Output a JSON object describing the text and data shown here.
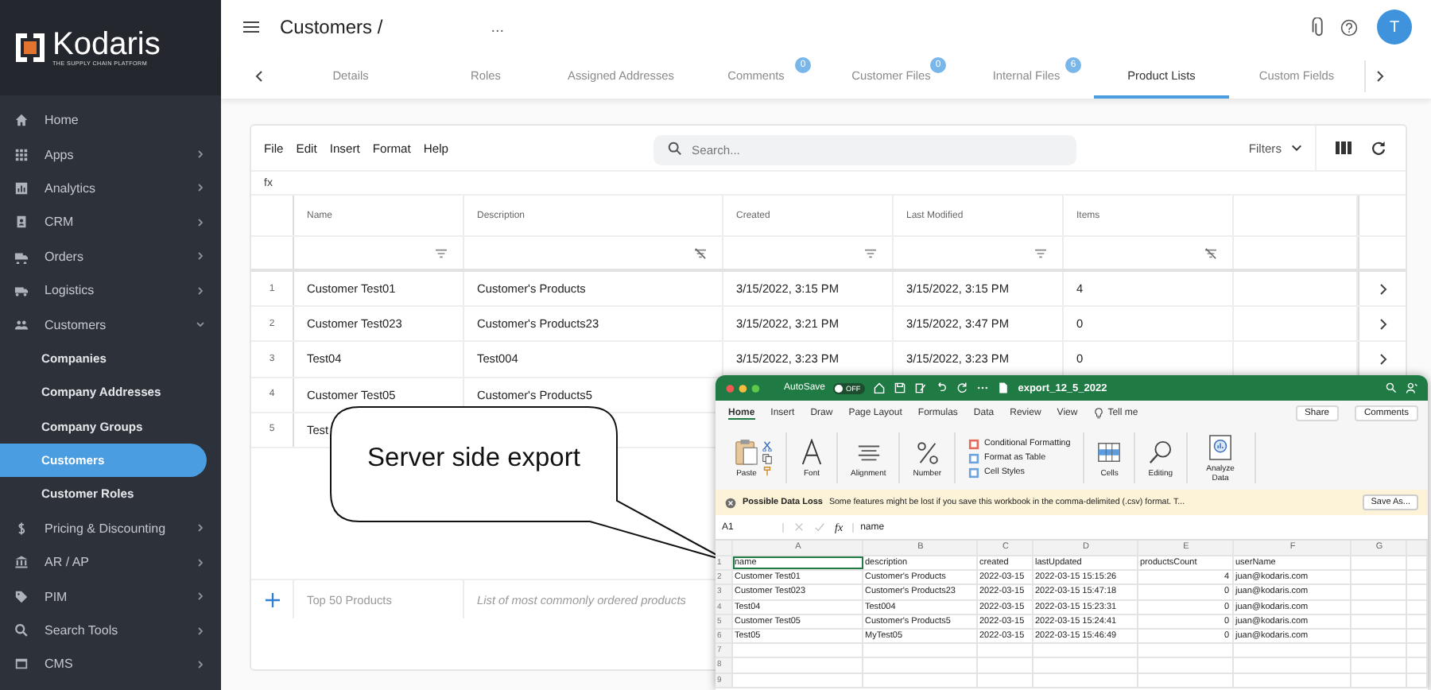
{
  "sidebar": {
    "logo": {
      "name": "Kodaris",
      "tagline": "THE SUPPLY CHAIN PLATFORM"
    },
    "items": [
      {
        "kind": "home",
        "label": "Home"
      },
      {
        "kind": "grid",
        "label": "Apps",
        "expanded": false
      },
      {
        "kind": "chart",
        "label": "Analytics",
        "expanded": false
      },
      {
        "kind": "contact",
        "label": "CRM",
        "expanded": false
      },
      {
        "kind": "truck",
        "label": "Orders",
        "expanded": false
      },
      {
        "kind": "van",
        "label": "Logistics",
        "expanded": false
      },
      {
        "kind": "people",
        "label": "Customers",
        "expanded": true,
        "children": [
          {
            "label": "Companies",
            "selected": false
          },
          {
            "label": "Company Addresses",
            "selected": false
          },
          {
            "label": "Company Groups",
            "selected": false
          },
          {
            "label": "Customers",
            "selected": true
          },
          {
            "label": "Customer Roles",
            "selected": false
          }
        ]
      },
      {
        "kind": "dollar",
        "label": "Pricing & Discounting",
        "expanded": false
      },
      {
        "kind": "bank",
        "label": "AR / AP",
        "expanded": false
      },
      {
        "kind": "tag",
        "label": "PIM",
        "expanded": false
      },
      {
        "kind": "search",
        "label": "Search Tools",
        "expanded": false
      },
      {
        "kind": "window",
        "label": "CMS",
        "expanded": false
      }
    ]
  },
  "header": {
    "title": "Customers /",
    "title_rest": "...",
    "avatar": "T"
  },
  "tabs": [
    {
      "label": "Details",
      "selected": false
    },
    {
      "label": "Roles",
      "selected": false
    },
    {
      "label": "Assigned Addresses",
      "selected": false
    },
    {
      "label": "Comments",
      "badge": "0",
      "selected": false
    },
    {
      "label": "Customer Files",
      "badge": "0",
      "selected": false
    },
    {
      "label": "Internal Files",
      "badge": "6",
      "selected": false
    },
    {
      "label": "Product Lists",
      "selected": true
    },
    {
      "label": "Custom Fields",
      "selected": false
    }
  ],
  "toolbar": {
    "menus": [
      "File",
      "Edit",
      "Insert",
      "Format",
      "Help"
    ],
    "search_placeholder": "Search...",
    "filters": "Filters"
  },
  "formula_label": "fx",
  "table": {
    "columns": [
      {
        "label": "Name",
        "filter_enabled": true
      },
      {
        "label": "Description",
        "filter_enabled": false
      },
      {
        "label": "Created",
        "filter_enabled": true
      },
      {
        "label": "Last Modified",
        "filter_enabled": true
      },
      {
        "label": "Items",
        "filter_enabled": false
      }
    ],
    "rows": [
      {
        "number": "1",
        "cells": [
          "Customer Test01",
          "Customer's Products",
          "3/15/2022, 3:15 PM",
          "3/15/2022, 3:15 PM",
          "4"
        ]
      },
      {
        "number": "2",
        "cells": [
          "Customer Test023",
          "Customer's Products23",
          "3/15/2022, 3:21 PM",
          "3/15/2022, 3:47 PM",
          "0"
        ]
      },
      {
        "number": "3",
        "cells": [
          "Test04",
          "Test004",
          "3/15/2022, 3:23 PM",
          "3/15/2022, 3:23 PM",
          "0"
        ]
      },
      {
        "number": "4",
        "cells": [
          "Customer Test05",
          "Customer's Products5"
        ]
      },
      {
        "number": "5",
        "cells": [
          "Test"
        ]
      }
    ],
    "new_row": {
      "name_placeholder": "Top 50 Products",
      "description_placeholder": "List of most commonly ordered products"
    }
  },
  "callout": {
    "text": "Server side export"
  },
  "excel": {
    "title": "export_12_5_2022",
    "autosave": {
      "label": "AutoSave",
      "state_text": "OFF",
      "on": false
    },
    "ribbon_tabs": [
      {
        "label": "Home",
        "selected": true
      },
      {
        "label": "Insert",
        "selected": false
      },
      {
        "label": "Draw",
        "selected": false
      },
      {
        "label": "Page Layout",
        "selected": false
      },
      {
        "label": "Formulas",
        "selected": false
      },
      {
        "label": "Data",
        "selected": false
      },
      {
        "label": "Review",
        "selected": false
      },
      {
        "label": "View",
        "selected": false
      }
    ],
    "tell_me": "Tell me",
    "share": "Share",
    "comments": "Comments",
    "ribbon_groups": [
      {
        "kind": "paste",
        "label": "Paste"
      },
      {
        "kind": "font",
        "label": "Font"
      },
      {
        "kind": "alignment",
        "label": "Alignment"
      },
      {
        "kind": "number",
        "label": "Number"
      },
      {
        "kind": "styles",
        "items": [
          "Conditional Formatting",
          "Format as Table",
          "Cell Styles"
        ]
      },
      {
        "kind": "cells",
        "label": "Cells"
      },
      {
        "kind": "editing",
        "label": "Editing"
      },
      {
        "kind": "analyze",
        "label": "Analyze Data"
      }
    ],
    "warning": {
      "title": "Possible Data Loss",
      "message": "Some features might be lost if you save this workbook in the comma-delimited (.csv) format. T...",
      "button": "Save As..."
    },
    "formula_bar": {
      "cell": "A1",
      "fx": "fx",
      "value": "name"
    },
    "grid": {
      "columns": [
        {
          "label": "A"
        },
        {
          "label": "B"
        },
        {
          "label": "C"
        },
        {
          "label": "D"
        },
        {
          "label": "E"
        },
        {
          "label": "F"
        },
        {
          "label": "G"
        }
      ],
      "rows": [
        {
          "number": "1",
          "cells": [
            {
              "text": "name",
              "selected": true
            },
            {
              "text": "description",
              "selected": false
            },
            {
              "text": "created",
              "selected": false
            },
            {
              "text": "lastUpdated",
              "selected": false
            },
            {
              "text": "productsCount",
              "selected": false
            },
            {
              "text": "userName",
              "selected": false
            }
          ]
        },
        {
          "number": "2",
          "cells": [
            {
              "text": "Customer Test01",
              "selected": false
            },
            {
              "text": "Customer's Products",
              "selected": false
            },
            {
              "text": "2022-03-15",
              "selected": false
            },
            {
              "text": "2022-03-15 15:15:26",
              "selected": false
            },
            {
              "text": "4",
              "selected": false
            },
            {
              "text": "juan@kodaris.com",
              "selected": false
            }
          ]
        },
        {
          "number": "3",
          "cells": [
            {
              "text": "Customer Test023",
              "selected": false
            },
            {
              "text": "Customer's Products23",
              "selected": false
            },
            {
              "text": "2022-03-15",
              "selected": false
            },
            {
              "text": "2022-03-15 15:47:18",
              "selected": false
            },
            {
              "text": "0",
              "selected": false
            },
            {
              "text": "juan@kodaris.com",
              "selected": false
            }
          ]
        },
        {
          "number": "4",
          "cells": [
            {
              "text": "Test04",
              "selected": false
            },
            {
              "text": "Test004",
              "selected": false
            },
            {
              "text": "2022-03-15",
              "selected": false
            },
            {
              "text": "2022-03-15 15:23:31",
              "selected": false
            },
            {
              "text": "0",
              "selected": false
            },
            {
              "text": "juan@kodaris.com",
              "selected": false
            }
          ]
        },
        {
          "number": "5",
          "cells": [
            {
              "text": "Customer Test05",
              "selected": false
            },
            {
              "text": "Customer's Products5",
              "selected": false
            },
            {
              "text": "2022-03-15",
              "selected": false
            },
            {
              "text": "2022-03-15 15:24:41",
              "selected": false
            },
            {
              "text": "0",
              "selected": false
            },
            {
              "text": "juan@kodaris.com",
              "selected": false
            }
          ]
        },
        {
          "number": "6",
          "cells": [
            {
              "text": "Test05",
              "selected": false
            },
            {
              "text": "MyTest05",
              "selected": false
            },
            {
              "text": "2022-03-15",
              "selected": false
            },
            {
              "text": "2022-03-15 15:46:49",
              "selected": false
            },
            {
              "text": "0",
              "selected": false
            },
            {
              "text": "juan@kodaris.com",
              "selected": false
            }
          ]
        },
        {
          "number": "7"
        },
        {
          "number": "8"
        },
        {
          "number": "9"
        }
      ]
    }
  }
}
